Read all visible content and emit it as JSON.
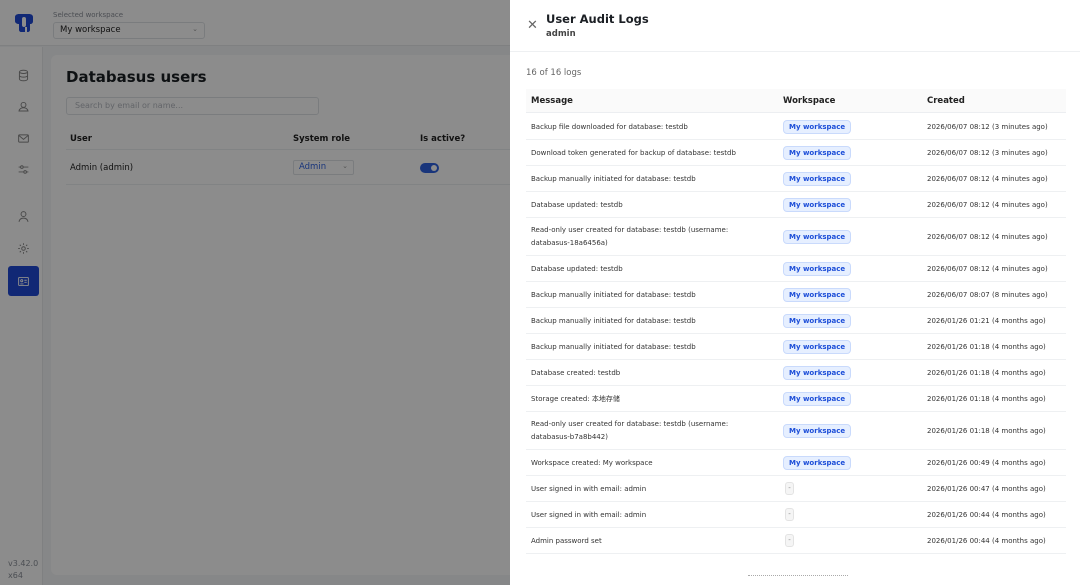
{
  "app": {
    "workspace_caption": "Selected workspace",
    "workspace_name": "My workspace",
    "version": "v3.42.0",
    "arch": "x64",
    "sidebar": [
      {
        "icon": "database-icon",
        "active": false
      },
      {
        "icon": "cloud-icon",
        "active": false
      },
      {
        "icon": "mail-icon",
        "active": false
      },
      {
        "icon": "sliders-icon",
        "active": false
      },
      {
        "icon": "user-icon",
        "active": false
      },
      {
        "icon": "gear-icon",
        "active": false
      },
      {
        "icon": "id-card-icon",
        "active": true
      }
    ]
  },
  "users_page": {
    "title": "Databasus users",
    "search_placeholder": "Search by email or name...",
    "columns": [
      "User",
      "System role",
      "Is active?"
    ],
    "rows": [
      {
        "user": "Admin (admin)",
        "role": "Admin",
        "active": true
      }
    ]
  },
  "drawer": {
    "title": "User Audit Logs",
    "subtitle": "admin",
    "count_text": "16 of 16 logs",
    "columns": {
      "message": "Message",
      "workspace": "Workspace",
      "created": "Created"
    },
    "logs": [
      {
        "message": "Backup file downloaded for database: testdb",
        "workspace": "My workspace",
        "created": "2026/06/07 08:12 (3 minutes ago)"
      },
      {
        "message": "Download token generated for backup of database: testdb",
        "workspace": "My workspace",
        "created": "2026/06/07 08:12 (3 minutes ago)"
      },
      {
        "message": "Backup manually initiated for database: testdb",
        "workspace": "My workspace",
        "created": "2026/06/07 08:12 (4 minutes ago)"
      },
      {
        "message": "Database updated: testdb",
        "workspace": "My workspace",
        "created": "2026/06/07 08:12 (4 minutes ago)"
      },
      {
        "message": "Read-only user created for database: testdb (username: databasus-18a6456a)",
        "workspace": "My workspace",
        "created": "2026/06/07 08:12 (4 minutes ago)"
      },
      {
        "message": "Database updated: testdb",
        "workspace": "My workspace",
        "created": "2026/06/07 08:12 (4 minutes ago)"
      },
      {
        "message": "Backup manually initiated for database: testdb",
        "workspace": "My workspace",
        "created": "2026/06/07 08:07 (8 minutes ago)"
      },
      {
        "message": "Backup manually initiated for database: testdb",
        "workspace": "My workspace",
        "created": "2026/01/26 01:21 (4 months ago)"
      },
      {
        "message": "Backup manually initiated for database: testdb",
        "workspace": "My workspace",
        "created": "2026/01/26 01:18 (4 months ago)"
      },
      {
        "message": "Database created: testdb",
        "workspace": "My workspace",
        "created": "2026/01/26 01:18 (4 months ago)"
      },
      {
        "message": "Storage created: 本地存储",
        "workspace": "My workspace",
        "created": "2026/01/26 01:18 (4 months ago)"
      },
      {
        "message": "Read-only user created for database: testdb (username: databasus-b7a8b442)",
        "workspace": "My workspace",
        "created": "2026/01/26 01:18 (4 months ago)"
      },
      {
        "message": "Workspace created: My workspace",
        "workspace": "My workspace",
        "created": "2026/01/26 00:49 (4 months ago)"
      },
      {
        "message": "User signed in with email: admin",
        "workspace": "-",
        "created": "2026/01/26 00:47 (4 months ago)"
      },
      {
        "message": "User signed in with email: admin",
        "workspace": "-",
        "created": "2026/01/26 00:44 (4 months ago)"
      },
      {
        "message": "Admin password set",
        "workspace": "-",
        "created": "2026/01/26 00:44 (4 months ago)"
      }
    ]
  }
}
